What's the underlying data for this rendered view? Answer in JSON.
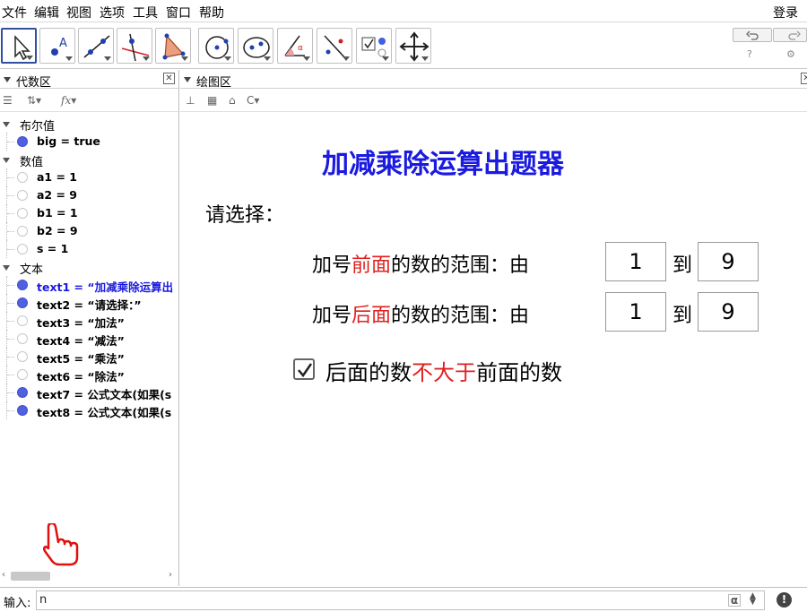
{
  "menu": {
    "items": [
      "文件",
      "编辑",
      "视图",
      "选项",
      "工具",
      "窗口",
      "帮助"
    ],
    "login": "登录"
  },
  "toolbar": {
    "tools": [
      {
        "name": "move-tool",
        "icon": "arrow-cursor-icon"
      },
      {
        "name": "point-tool",
        "icon": "point-a-icon"
      },
      {
        "name": "line-tool",
        "icon": "line-icon"
      },
      {
        "name": "perpendicular-tool",
        "icon": "perpendicular-icon"
      },
      {
        "name": "polygon-tool",
        "icon": "polygon-icon"
      },
      {
        "name": "circle-tool",
        "icon": "circle-icon"
      },
      {
        "name": "ellipse-tool",
        "icon": "ellipse-icon"
      },
      {
        "name": "angle-tool",
        "icon": "angle-icon"
      },
      {
        "name": "reflect-tool",
        "icon": "reflect-icon"
      },
      {
        "name": "checkbox-tool",
        "icon": "checkbox-icon"
      },
      {
        "name": "move-view-tool",
        "icon": "move-cross-icon"
      }
    ]
  },
  "algebra": {
    "title": "代数区",
    "groups": [
      {
        "header": "布尔值",
        "items": [
          {
            "text": "big = true",
            "visible": true,
            "highlight": false
          }
        ]
      },
      {
        "header": "数值",
        "items": [
          {
            "text": "a1 = 1",
            "visible": false,
            "highlight": false
          },
          {
            "text": "a2 = 9",
            "visible": false,
            "highlight": false
          },
          {
            "text": "b1 = 1",
            "visible": false,
            "highlight": false
          },
          {
            "text": "b2 = 9",
            "visible": false,
            "highlight": false
          },
          {
            "text": "s = 1",
            "visible": false,
            "highlight": false
          }
        ]
      },
      {
        "header": "文本",
        "items": [
          {
            "text": "text1 = “加减乘除运算出",
            "visible": true,
            "highlight": true
          },
          {
            "text": "text2 = “请选择：”",
            "visible": true,
            "highlight": false
          },
          {
            "text": "text3 = “加法”",
            "visible": false,
            "highlight": false
          },
          {
            "text": "text4 = “减法”",
            "visible": false,
            "highlight": false
          },
          {
            "text": "text5 = “乘法”",
            "visible": false,
            "highlight": false
          },
          {
            "text": "text6 = “除法”",
            "visible": false,
            "highlight": false
          },
          {
            "text": "text7 = 公式文本(如果(s",
            "visible": true,
            "highlight": false
          },
          {
            "text": "text8 = 公式文本(如果(s",
            "visible": true,
            "highlight": false
          }
        ]
      }
    ]
  },
  "graphics": {
    "title": "绘图区",
    "heading": "加减乘除运算出题器",
    "prompt": "请选择：",
    "range1": {
      "pre": "加号",
      "red": "前面",
      "post": "的数的范围：由",
      "from": "1",
      "to_label": "到",
      "to": "9"
    },
    "range2": {
      "pre": "加号",
      "red": "后面",
      "post": "的数的范围：由",
      "from": "1",
      "to_label": "到",
      "to": "9"
    },
    "checkbox": {
      "checked": true,
      "pre": "后面的数",
      "red": "不大于",
      "post": "前面的数"
    }
  },
  "input": {
    "label": "输入:",
    "value": "n",
    "alpha": "α"
  },
  "colors": {
    "accent_blue": "#1a1ae0",
    "red_text": "#e02020",
    "dot_on": "#5060e0"
  }
}
